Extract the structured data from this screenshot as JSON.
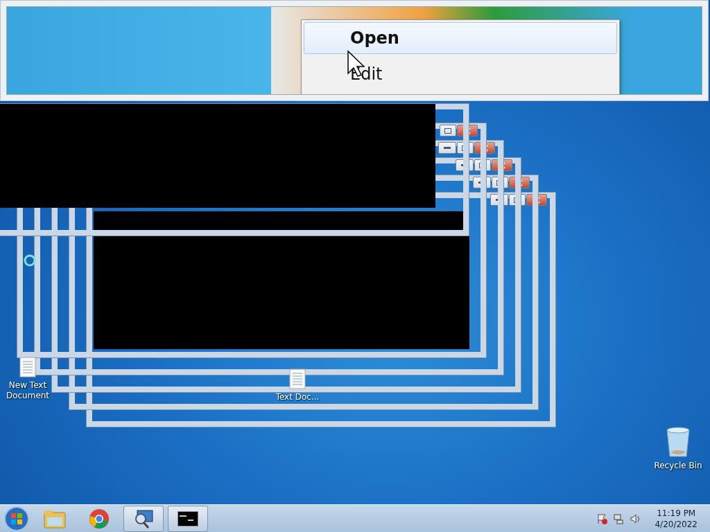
{
  "thumbnail_preview": {
    "context_menu": [
      {
        "label": "Open",
        "selected": true
      },
      {
        "label": "Edit",
        "selected": false
      }
    ]
  },
  "desktop_icons": [
    {
      "kind": "text",
      "label": "New Text Document"
    },
    {
      "kind": "text",
      "label": "Text Doc..."
    },
    {
      "kind": "recycle",
      "label": "Recycle Bin"
    }
  ],
  "taskbar": {
    "items": [
      {
        "kind": "folder",
        "active": false
      },
      {
        "kind": "browser",
        "active": false
      },
      {
        "kind": "magnifier",
        "active": true
      },
      {
        "kind": "console",
        "active": true
      }
    ],
    "clock": {
      "time": "11:19 PM",
      "date": "4/20/2022"
    }
  }
}
